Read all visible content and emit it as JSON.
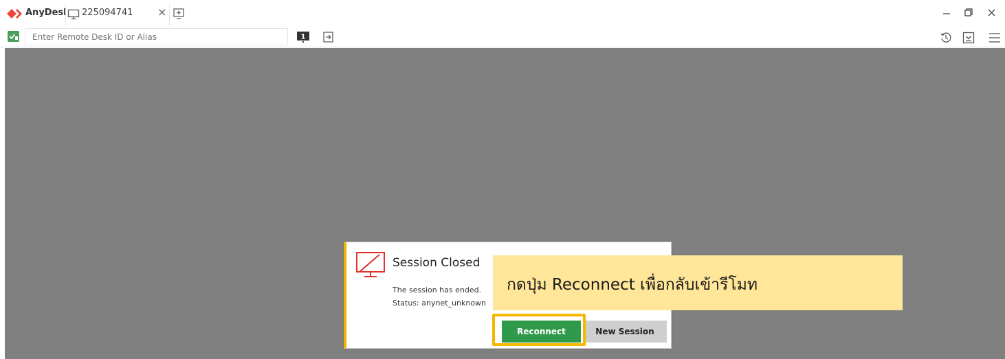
{
  "titlebar": {
    "app_name": "AnyDesk",
    "tab_label": "225094741",
    "tab_close": "×",
    "brand_color": "#ef443b"
  },
  "toolbar": {
    "address_placeholder": "Enter Remote Desk ID or Alias",
    "display_badge": "1"
  },
  "dialog": {
    "title": "Session Closed",
    "message": "The session has ended.",
    "status": "Status: anynet_unknown",
    "reconnect_label": "Reconnect",
    "new_session_label": "New Session",
    "reconnect_color": "#2e9a4a",
    "accent_color": "#f2b300"
  },
  "annotation": {
    "callout_text": "กดปุ่ม Reconnect เพื่อกลับเข้ารีโมท",
    "highlight_color": "#f5b800",
    "callout_bg": "#ffe699"
  },
  "icons": [
    "anydesk-logo-icon",
    "monitor-icon",
    "new-tab-icon",
    "minimize-icon",
    "restore-icon",
    "close-icon",
    "status-icon",
    "display-icon",
    "connect-arrow-icon",
    "history-icon",
    "download-icon",
    "menu-icon",
    "monitor-off-icon"
  ]
}
